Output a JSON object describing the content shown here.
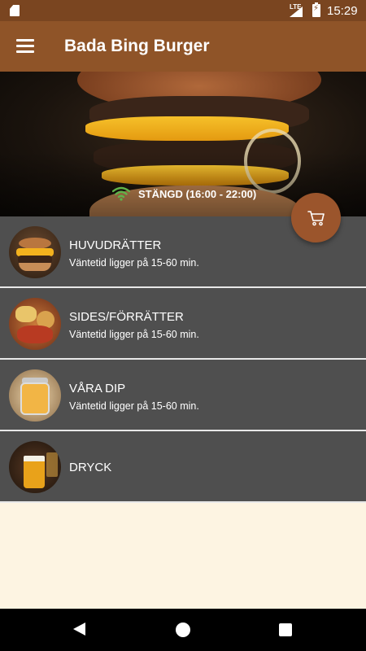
{
  "status_bar": {
    "network": "LTE",
    "time": "15:29",
    "icons": [
      "sd-card-icon",
      "signal-icon",
      "battery-charging-icon"
    ]
  },
  "app_bar": {
    "title": "Bada Bing Burger",
    "menu_icon": "hamburger-menu-icon"
  },
  "hero": {
    "status_icon": "wifi-icon",
    "status_text": "STÄNGD (16:00 - 22:00)",
    "status_icon_color": "#5fb34a"
  },
  "cart_button": {
    "icon": "shopping-cart-icon",
    "color": "#9b552c"
  },
  "menu": {
    "items": [
      {
        "title": "HUVUDRÄTTER",
        "subtitle": "Väntetid ligger på 15-60 min."
      },
      {
        "title": "SIDES/FÖRRÄTTER",
        "subtitle": "Väntetid ligger på 15-60 min."
      },
      {
        "title": "VÅRA DIP",
        "subtitle": "Väntetid ligger på 15-60 min."
      },
      {
        "title": "DRYCK"
      }
    ]
  },
  "colors": {
    "status_bar": "#7a4520",
    "app_bar": "#8f5428",
    "list_row": "#4f4f4f",
    "background": "#fdf4e2"
  },
  "nav_bar": {
    "icons": [
      "back-icon",
      "home-icon",
      "recents-icon"
    ]
  }
}
